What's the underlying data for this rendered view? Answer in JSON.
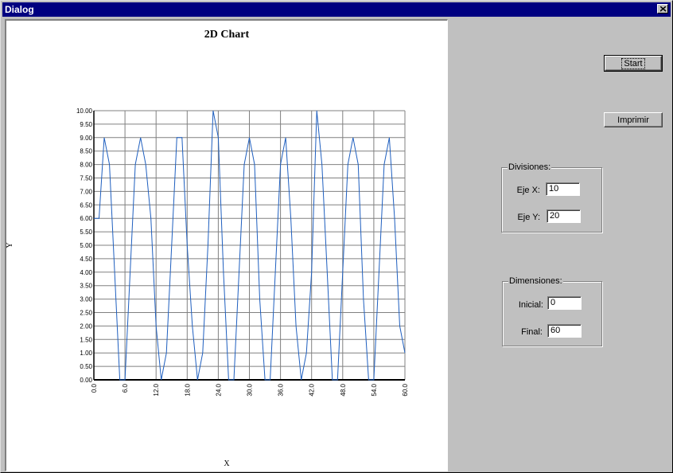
{
  "window": {
    "title": "Dialog"
  },
  "buttons": {
    "start": "Start",
    "print": "Imprimir"
  },
  "divisiones": {
    "label": "Divisiones:",
    "eje_x_label": "Eje X:",
    "eje_x_value": "10",
    "eje_y_label": "Eje Y:",
    "eje_y_value": "20"
  },
  "dimensiones": {
    "label": "Dimensiones:",
    "inicial_label": "Inicial:",
    "inicial_value": "0",
    "final_label": "Final:",
    "final_value": "60"
  },
  "colors": {
    "line": "#1f5fbf",
    "title_bar": "#000080"
  },
  "chart_data": {
    "type": "line",
    "title": "2D Chart",
    "xlabel": "X",
    "ylabel": "Y",
    "xlim": [
      0,
      60
    ],
    "ylim": [
      0,
      10
    ],
    "grid": true,
    "x_ticks": [
      "0.0",
      "6.0",
      "12.0",
      "18.0",
      "24.0",
      "30.0",
      "36.0",
      "42.0",
      "48.0",
      "54.0",
      "60.0"
    ],
    "y_ticks": [
      "0.00",
      "0.50",
      "1.00",
      "1.50",
      "2.00",
      "2.50",
      "3.00",
      "3.50",
      "4.00",
      "4.50",
      "5.00",
      "5.50",
      "6.00",
      "6.50",
      "7.00",
      "7.50",
      "8.00",
      "8.50",
      "9.00",
      "9.50",
      "10.00"
    ],
    "x": [
      0,
      1,
      2,
      3,
      4,
      5,
      6,
      7,
      8,
      9,
      10,
      11,
      12,
      13,
      14,
      15,
      16,
      17,
      18,
      19,
      20,
      21,
      22,
      23,
      24,
      25,
      26,
      27,
      28,
      29,
      30,
      31,
      32,
      33,
      34,
      35,
      36,
      37,
      38,
      39,
      40,
      41,
      42,
      43,
      44,
      45,
      46,
      47,
      48,
      49,
      50,
      51,
      52,
      53,
      54,
      55,
      56,
      57,
      58,
      59,
      60
    ],
    "y": [
      6,
      6,
      9,
      8,
      4,
      0,
      0,
      4,
      8,
      9,
      8,
      6,
      2,
      0,
      1,
      5,
      9,
      9,
      5,
      2,
      0,
      1,
      5,
      10,
      9,
      4,
      0,
      0,
      4,
      8,
      9,
      8,
      3,
      0,
      0,
      4,
      8,
      9,
      6,
      2,
      0,
      1,
      4,
      10,
      8,
      4,
      0,
      0,
      4,
      8,
      9,
      8,
      3,
      0,
      0,
      4,
      8,
      9,
      6,
      2,
      1
    ]
  }
}
